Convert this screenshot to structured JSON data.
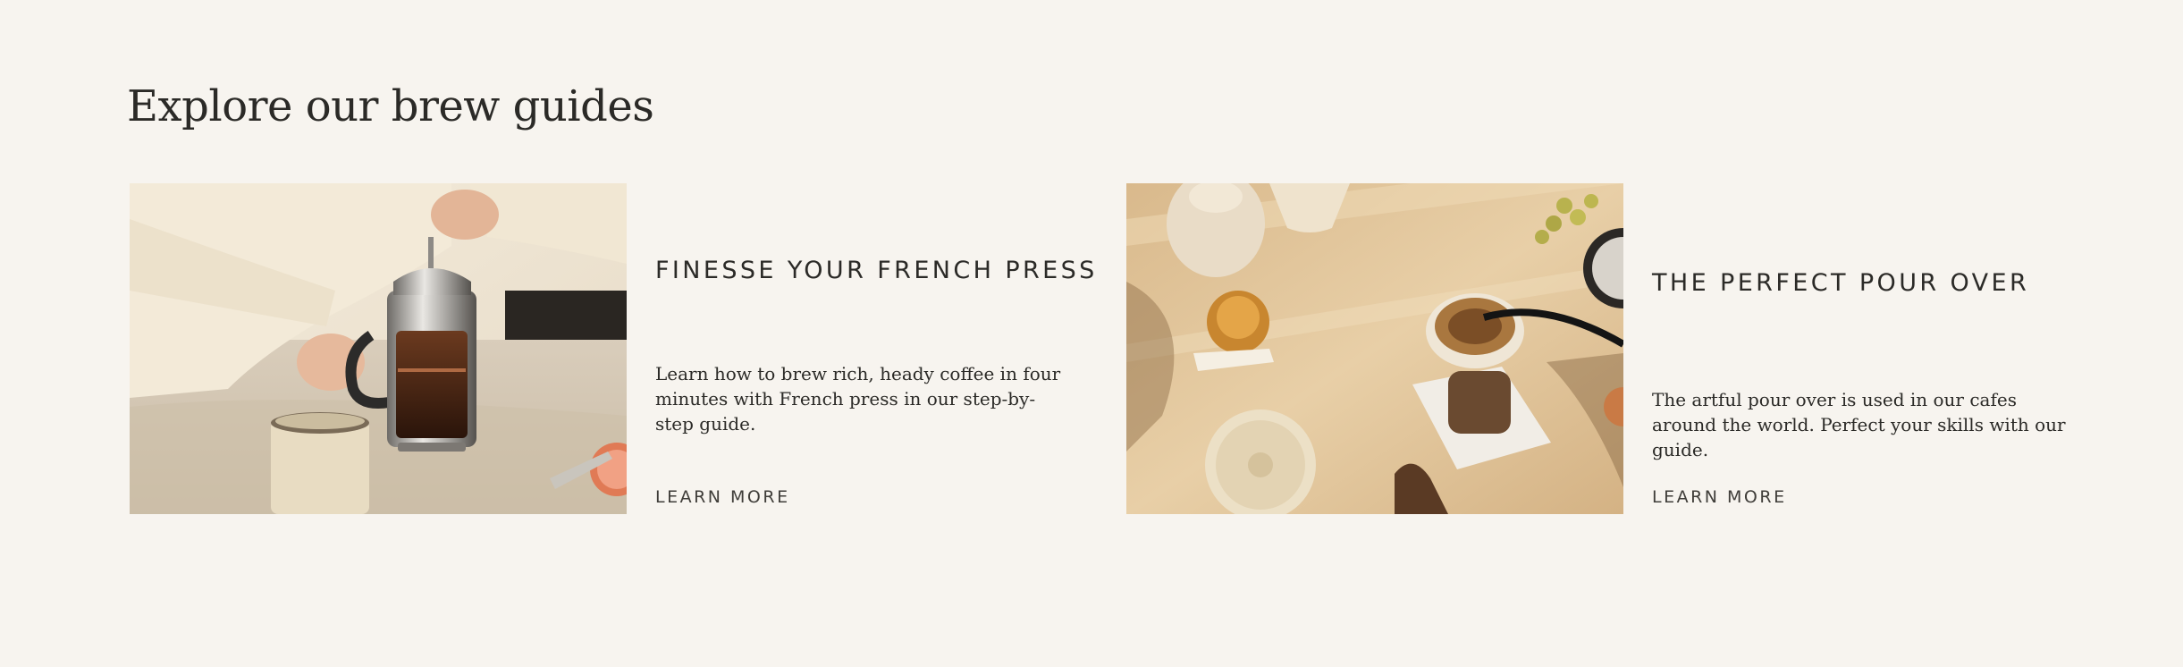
{
  "section": {
    "title": "Explore our brew guides"
  },
  "guides": [
    {
      "title": "FINESSE YOUR FRENCH PRESS",
      "description": "Learn how to brew rich, heady coffee in four minutes with French press in our step-by-step guide.",
      "link_label": "LEARN MORE",
      "image": "french-press-photo"
    },
    {
      "title": "THE PERFECT POUR OVER",
      "description": "The artful pour over is used in our cafes around the world. Perfect your skills with our guide.",
      "link_label": "LEARN MORE",
      "image": "pour-over-photo"
    }
  ],
  "colors": {
    "background": "#f7f4ef",
    "text": "#2b2a27",
    "link": "#3f3d39"
  }
}
